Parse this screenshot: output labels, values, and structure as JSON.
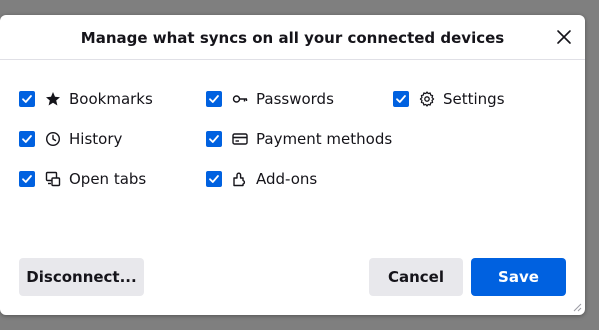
{
  "dialog": {
    "title": "Manage what syncs on all your connected devices",
    "close_label": "Close"
  },
  "options": {
    "bookmarks": {
      "label": "Bookmarks",
      "checked": true,
      "icon": "star-icon"
    },
    "history": {
      "label": "History",
      "checked": true,
      "icon": "clock-icon"
    },
    "open_tabs": {
      "label": "Open tabs",
      "checked": true,
      "icon": "synced-tabs-icon"
    },
    "passwords": {
      "label": "Passwords",
      "checked": true,
      "icon": "key-icon"
    },
    "payment_methods": {
      "label": "Payment methods",
      "checked": true,
      "icon": "credit-card-icon"
    },
    "addons": {
      "label": "Add-ons",
      "checked": true,
      "icon": "puzzle-piece-icon"
    },
    "settings": {
      "label": "Settings",
      "checked": true,
      "icon": "gear-icon"
    }
  },
  "buttons": {
    "disconnect": "Disconnect...",
    "cancel": "Cancel",
    "save": "Save"
  },
  "colors": {
    "accent": "#0061e0",
    "secondary_button": "#e8e8ec",
    "text": "#15141a"
  }
}
